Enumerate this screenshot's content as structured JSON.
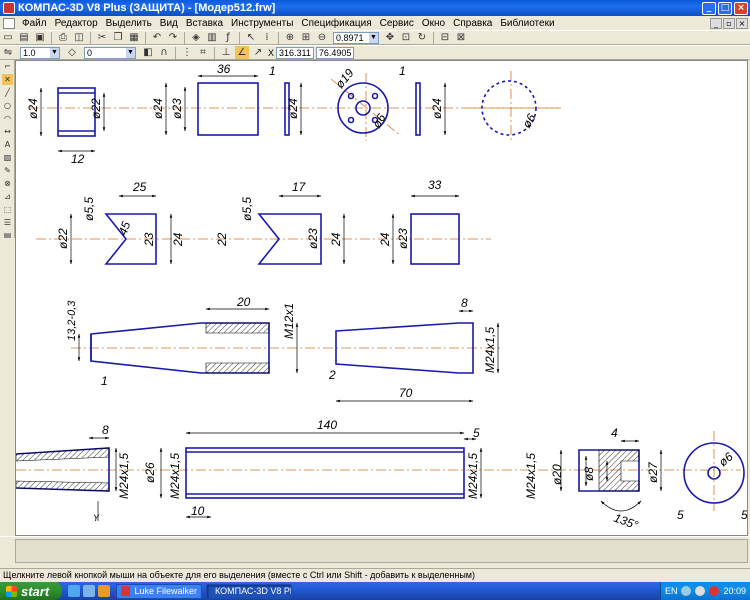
{
  "window": {
    "title": "КОМПАС-3D V8 Plus (ЗАЩИТА) - [Модер512.frw]",
    "controls": [
      "_",
      "□",
      "×"
    ]
  },
  "menu": {
    "items": [
      "Файл",
      "Редактор",
      "Выделить",
      "Вид",
      "Вставка",
      "Инструменты",
      "Спецификация",
      "Сервис",
      "Окно",
      "Справка",
      "Библиотеки"
    ]
  },
  "toolbar2": {
    "scale_value": "1.0",
    "layer_value": "0",
    "zoom_value": "0.8971",
    "coord_x": "316.311",
    "coord_y": "76.4905"
  },
  "drawing": {
    "dims": {
      "d24_a": "ø24",
      "d22_a": "ø22",
      "len12": "12",
      "d24_b": "ø24",
      "d23_a": "ø23",
      "len36": "36",
      "len1_a": "1",
      "d24_c": "ø24",
      "d19": "ø19",
      "d6_a": "ø6",
      "len1_b": "1",
      "d24_d": "ø24",
      "d6_b": "ø6",
      "d22_b": "ø22",
      "d55_a": "ø5,5",
      "len25": "25",
      "ang45": "45",
      "d23_b": "23",
      "n24_a": "24",
      "n22": "22",
      "d55_b": "ø5,5",
      "len17": "17",
      "d23_c": "ø23",
      "n24_b": "24",
      "n24_c": "24",
      "d23_d": "ø23",
      "len33": "33",
      "tol132": "13,2-0,3",
      "len20": "20",
      "m12": "M12x1",
      "label1": "1",
      "len8_a": "8",
      "m24_a": "M24x1,5",
      "label2": "2",
      "len70": "70",
      "len8_b": "8",
      "m24_b": "M24x1,5",
      "len140": "140",
      "len5": "5",
      "d26": "ø26",
      "m24_c": "M24x1,5",
      "m24_d": "M24x1,5",
      "len10": "10",
      "len4": "4",
      "m24_e": "M24x1,5",
      "d20": "ø20",
      "d8": "ø8",
      "ang135": "135°",
      "d27": "ø27",
      "label5a": "5",
      "d6_c": "ø6",
      "label5b": "5",
      "axis_y": "Y"
    }
  },
  "status": {
    "text": "Щелкните левой кнопкой мыши на объекте для его выделения (вместе с Ctrl или Shift - добавить к выделенным)"
  },
  "taskbar": {
    "start": "start",
    "tasks": [
      "Luke Filewalker",
      "КОМПАС-3D V8 Plus ..."
    ],
    "lang": "EN",
    "clock": "20:09"
  },
  "colors": {
    "part_outline": "#1a1aa8",
    "axis": "#d0782a",
    "dim": "#000000",
    "titlebar": "#0a5bd8"
  }
}
